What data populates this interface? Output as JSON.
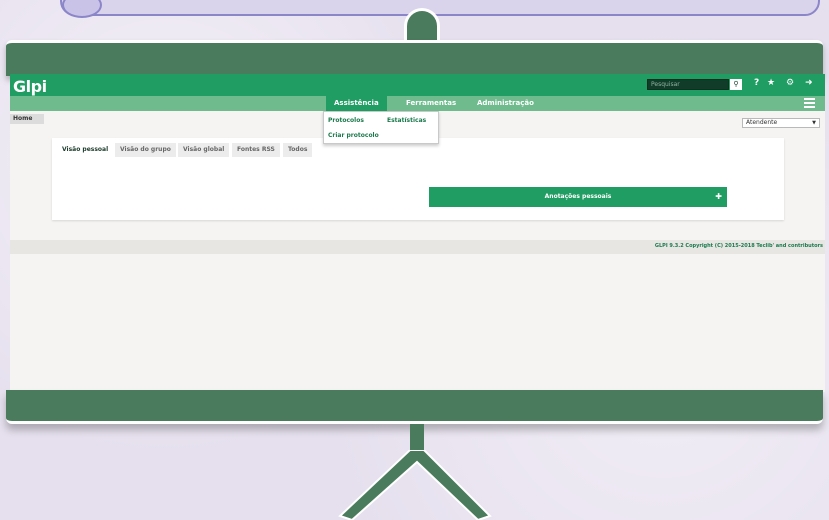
{
  "app": {
    "logo_text": "Glpi",
    "search_placeholder": "Pesquisar",
    "header_icons": [
      "search-icon",
      "help-icon",
      "star-icon",
      "gear-icon",
      "logout-icon"
    ],
    "help_glyph": "?",
    "nav": {
      "assistencia": "Assistência",
      "ferramentas": "Ferramentas",
      "administracao": "Administração"
    },
    "dropdown": {
      "protocolos": "Protocolos",
      "estatisticas": "Estatísticas",
      "criar_protocolo": "Criar protocolo"
    },
    "breadcrumb_home": "Home",
    "profile_select": "Atendente",
    "tabs": {
      "visao_pessoal": "Visão pessoal",
      "visao_grupo": "Visão do grupo",
      "visao_global": "Visão global",
      "fontes_rss": "Fontes RSS",
      "todos": "Todos"
    },
    "notes_title": "Anotações pessoais",
    "footer": "GLPI 9.3.2 Copyright (C) 2015-2018 Teclib' and contributors"
  },
  "colors": {
    "header_green": "#1f9d62",
    "nav_green": "#6fbb8e",
    "case_green": "#4a7b5d"
  }
}
